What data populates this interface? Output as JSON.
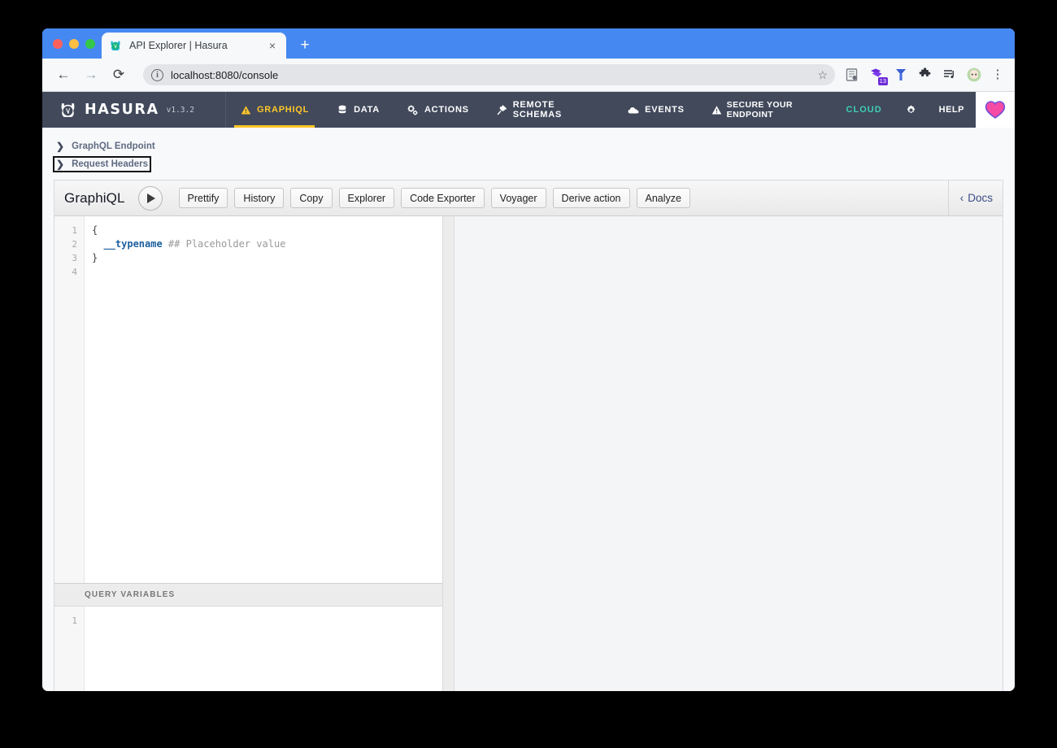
{
  "browser": {
    "tab": {
      "title": "API Explorer | Hasura",
      "favicon_name": "hasura-favicon",
      "close_label": "×",
      "new_tab_label": "+"
    },
    "nav": {
      "back_label": "←",
      "forward_label": "→",
      "reload_label": "⟳"
    },
    "url": {
      "text": "localhost:8080/console",
      "site_info_label": "i",
      "bookmark_label": "☆"
    },
    "extensions": [
      {
        "name": "reader-icon"
      },
      {
        "name": "pocket-icon",
        "badge": "13"
      },
      {
        "name": "yandex-icon"
      },
      {
        "name": "puzzle-extensions-icon"
      },
      {
        "name": "playlist-icon"
      },
      {
        "name": "profile-avatar"
      }
    ],
    "menu_label": "⋮"
  },
  "hasura_nav": {
    "brand": "HASURA",
    "version": "v1.3.2",
    "items": [
      {
        "label": "GRAPHIQL",
        "icon": "warning-triangle-icon",
        "active": true
      },
      {
        "label": "DATA",
        "icon": "database-icon",
        "active": false
      },
      {
        "label": "ACTIONS",
        "icon": "gears-icon",
        "active": false
      },
      {
        "label": "REMOTE SCHEMAS",
        "icon": "plug-icon",
        "active": false
      },
      {
        "label": "EVENTS",
        "icon": "cloud-icon",
        "active": false
      }
    ],
    "secure_endpoint": "SECURE YOUR ENDPOINT",
    "secure_endpoint_icon": "warning-triangle-icon",
    "cloud": "CLOUD",
    "settings_icon": "gear-icon",
    "help": "HELP",
    "love_icon": "heart-icon",
    "colors": {
      "navbar_bg": "#41495b",
      "active": "#ffc627",
      "cloud": "#3ecfb2",
      "heart": "#f64ba5"
    }
  },
  "collapsers": [
    {
      "label": "GraphQL Endpoint",
      "expanded": false,
      "focused": false
    },
    {
      "label": "Request Headers",
      "expanded": false,
      "focused": true
    }
  ],
  "graphiql": {
    "title": "GraphiQL",
    "execute_label": "▶",
    "buttons": [
      "Prettify",
      "History",
      "Copy",
      "Explorer",
      "Code Exporter",
      "Voyager",
      "Derive action",
      "Analyze"
    ],
    "docs_label": "Docs",
    "docs_chevron": "‹",
    "query_editor": {
      "line_numbers": [
        "1",
        "2",
        "3",
        "4"
      ],
      "lines": [
        [
          {
            "t": "{",
            "c": "tok-punct"
          }
        ],
        [
          {
            "t": "  ",
            "c": "tok-punct"
          },
          {
            "t": "__typename",
            "c": "tok-field"
          },
          {
            "t": " ## Placeholder value",
            "c": "tok-comment"
          }
        ],
        [
          {
            "t": "}",
            "c": "tok-punct"
          }
        ],
        [
          {
            "t": "",
            "c": "tok-punct"
          }
        ]
      ]
    },
    "variables": {
      "header": "QUERY VARIABLES",
      "line_numbers": [
        "1"
      ],
      "lines": [
        [
          {
            "t": "",
            "c": "tok-punct"
          }
        ]
      ]
    },
    "result": {
      "content": ""
    }
  }
}
